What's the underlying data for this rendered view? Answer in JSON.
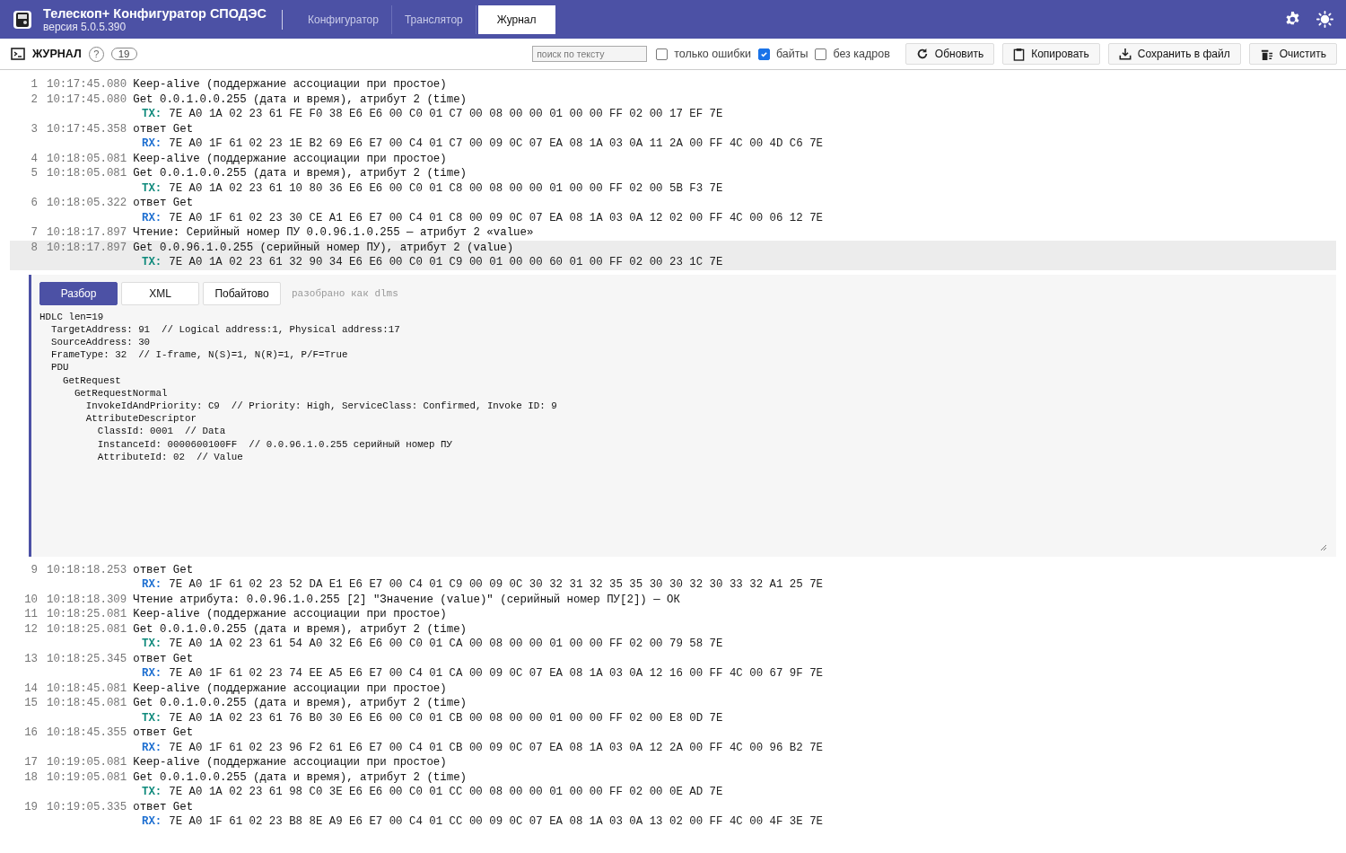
{
  "app": {
    "title": "Телескоп+ Конфигуратор СПОДЭС",
    "version": "версия 5.0.5.390"
  },
  "nav_tabs": [
    {
      "label": "Конфигуратор",
      "selected": false
    },
    {
      "label": "Транслятор",
      "selected": false
    },
    {
      "label": "Журнал",
      "selected": true
    }
  ],
  "toolbar": {
    "title": "ЖУРНАЛ",
    "help": "?",
    "count": "19",
    "search": {
      "placeholder": "поиск по тексту"
    },
    "checkboxes": [
      {
        "label": "только ошибки",
        "checked": false
      },
      {
        "label": "байты",
        "checked": true
      },
      {
        "label": "без кадров",
        "checked": false
      }
    ],
    "buttons": [
      {
        "label": "Обновить",
        "kind": "refresh"
      },
      {
        "label": "Копировать",
        "kind": "copy"
      },
      {
        "label": "Сохранить в файл",
        "kind": "save"
      },
      {
        "label": "Очистить",
        "kind": "clear"
      }
    ]
  },
  "log": [
    {
      "n": "1",
      "time": "10:17:45.080",
      "text": "Keep-alive (поддержание ассоциации при простое)",
      "selected": false
    },
    {
      "n": "2",
      "time": "10:17:45.080",
      "text": "Get 0.0.1.0.0.255 (дата и время), атрибут 2 (time)",
      "selected": false,
      "bytes": {
        "kind": "tx",
        "label": "TX:",
        "hex": "7E A0 1A 02 23 61 FE F0 38 E6 E6 00 C0 01 C7 00 08 00 00 01 00 00 FF 02 00 17 EF 7E"
      }
    },
    {
      "n": "3",
      "time": "10:17:45.358",
      "text": "ответ Get",
      "selected": false,
      "bytes": {
        "kind": "rx",
        "label": "RX:",
        "hex": "7E A0 1F 61 02 23 1E B2 69 E6 E7 00 C4 01 C7 00 09 0C 07 EA 08 1A 03 0A 11 2A 00 FF 4C 00 4D C6 7E"
      }
    },
    {
      "n": "4",
      "time": "10:18:05.081",
      "text": "Keep-alive (поддержание ассоциации при простое)",
      "selected": false
    },
    {
      "n": "5",
      "time": "10:18:05.081",
      "text": "Get 0.0.1.0.0.255 (дата и время), атрибут 2 (time)",
      "selected": false,
      "bytes": {
        "kind": "tx",
        "label": "TX:",
        "hex": "7E A0 1A 02 23 61 10 80 36 E6 E6 00 C0 01 C8 00 08 00 00 01 00 00 FF 02 00 5B F3 7E"
      }
    },
    {
      "n": "6",
      "time": "10:18:05.322",
      "text": "ответ Get",
      "selected": false,
      "bytes": {
        "kind": "rx",
        "label": "RX:",
        "hex": "7E A0 1F 61 02 23 30 CE A1 E6 E7 00 C4 01 C8 00 09 0C 07 EA 08 1A 03 0A 12 02 00 FF 4C 00 06 12 7E"
      }
    },
    {
      "n": "7",
      "time": "10:18:17.897",
      "text": "Чтение: Серийный номер ПУ 0.0.96.1.0.255 — атрибут 2 «value»",
      "selected": false
    },
    {
      "n": "8",
      "time": "10:18:17.897",
      "text": "Get 0.0.96.1.0.255 (серийный номер ПУ), атрибут 2 (value)",
      "selected": true,
      "bytes": {
        "kind": "tx",
        "label": "TX:",
        "hex": "7E A0 1A 02 23 61 32 90 34 E6 E6 00 C0 01 C9 00 01 00 00 60 01 00 FF 02 00 23 1C 7E"
      }
    },
    {
      "n": "9",
      "time": "10:18:18.253",
      "text": "ответ Get",
      "selected": false,
      "bytes": {
        "kind": "rx",
        "label": "RX:",
        "hex": "7E A0 1F 61 02 23 52 DA E1 E6 E7 00 C4 01 C9 00 09 0C 30 32 31 32 35 35 30 30 32 30 33 32 A1 25 7E"
      }
    },
    {
      "n": "10",
      "time": "10:18:18.309",
      "text": "Чтение атрибута: 0.0.96.1.0.255 [2] \"Значение (value)\" (серийный номер ПУ[2]) — ОК",
      "selected": false
    },
    {
      "n": "11",
      "time": "10:18:25.081",
      "text": "Keep-alive (поддержание ассоциации при простое)",
      "selected": false
    },
    {
      "n": "12",
      "time": "10:18:25.081",
      "text": "Get 0.0.1.0.0.255 (дата и время), атрибут 2 (time)",
      "selected": false,
      "bytes": {
        "kind": "tx",
        "label": "TX:",
        "hex": "7E A0 1A 02 23 61 54 A0 32 E6 E6 00 C0 01 CA 00 08 00 00 01 00 00 FF 02 00 79 58 7E"
      }
    },
    {
      "n": "13",
      "time": "10:18:25.345",
      "text": "ответ Get",
      "selected": false,
      "bytes": {
        "kind": "rx",
        "label": "RX:",
        "hex": "7E A0 1F 61 02 23 74 EE A5 E6 E7 00 C4 01 CA 00 09 0C 07 EA 08 1A 03 0A 12 16 00 FF 4C 00 67 9F 7E"
      }
    },
    {
      "n": "14",
      "time": "10:18:45.081",
      "text": "Keep-alive (поддержание ассоциации при простое)",
      "selected": false
    },
    {
      "n": "15",
      "time": "10:18:45.081",
      "text": "Get 0.0.1.0.0.255 (дата и время), атрибут 2 (time)",
      "selected": false,
      "bytes": {
        "kind": "tx",
        "label": "TX:",
        "hex": "7E A0 1A 02 23 61 76 B0 30 E6 E6 00 C0 01 CB 00 08 00 00 01 00 00 FF 02 00 E8 0D 7E"
      }
    },
    {
      "n": "16",
      "time": "10:18:45.355",
      "text": "ответ Get",
      "selected": false,
      "bytes": {
        "kind": "rx",
        "label": "RX:",
        "hex": "7E A0 1F 61 02 23 96 F2 61 E6 E7 00 C4 01 CB 00 09 0C 07 EA 08 1A 03 0A 12 2A 00 FF 4C 00 96 B2 7E"
      }
    },
    {
      "n": "17",
      "time": "10:19:05.081",
      "text": "Keep-alive (поддержание ассоциации при простое)",
      "selected": false
    },
    {
      "n": "18",
      "time": "10:19:05.081",
      "text": "Get 0.0.1.0.0.255 (дата и время), атрибут 2 (time)",
      "selected": false,
      "bytes": {
        "kind": "tx",
        "label": "TX:",
        "hex": "7E A0 1A 02 23 61 98 C0 3E E6 E6 00 C0 01 CC 00 08 00 00 01 00 00 FF 02 00 0E AD 7E"
      }
    },
    {
      "n": "19",
      "time": "10:19:05.335",
      "text": "ответ Get",
      "selected": false,
      "bytes": {
        "kind": "rx",
        "label": "RX:",
        "hex": "7E A0 1F 61 02 23 B8 8E A9 E6 E7 00 C4 01 CC 00 09 0C 07 EA 08 1A 03 0A 13 02 00 FF 4C 00 4F 3E 7E"
      }
    }
  ],
  "detail": {
    "tabs": [
      {
        "label": "Разбор",
        "selected": true
      },
      {
        "label": "XML",
        "selected": false
      },
      {
        "label": "Побайтово",
        "selected": false
      }
    ],
    "note": "разобрано как dlms",
    "tree": [
      {
        "text": "HDLC len=19",
        "children": [
          {
            "text": "TargetAddress: 91  // Logical address:1, Physical address:17"
          },
          {
            "text": "SourceAddress: 30"
          },
          {
            "text": "FrameType: 32  // I-frame, N(S)=1, N(R)=1, P/F=True"
          },
          {
            "text": "PDU",
            "children": [
              {
                "text": "GetRequest",
                "children": [
                  {
                    "text": "GetRequestNormal",
                    "children": [
                      {
                        "text": "InvokeIdAndPriority: C9  // Priority: High, ServiceClass: Confirmed, Invoke ID: 9"
                      },
                      {
                        "text": "AttributeDescriptor",
                        "children": [
                          {
                            "text": "ClassId: 0001  // Data"
                          },
                          {
                            "text": "InstanceId: 0000600100FF  // 0.0.96.1.0.255 серийный номер ПУ"
                          },
                          {
                            "text": "AttributeId: 02  // Value"
                          }
                        ]
                      }
                    ]
                  }
                ]
              }
            ]
          }
        ]
      }
    ]
  }
}
